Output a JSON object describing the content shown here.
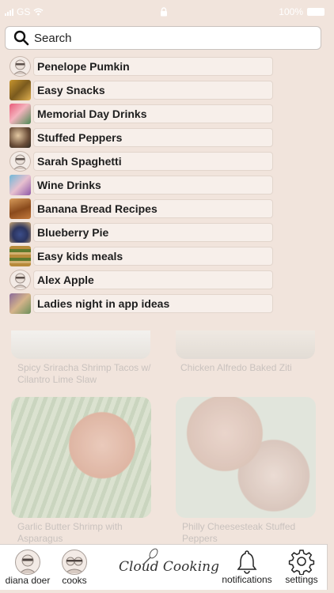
{
  "status_bar": {
    "carrier": "GS",
    "battery": "100%"
  },
  "search": {
    "placeholder": "Search",
    "value": ""
  },
  "results": [
    {
      "label": "Penelope Pumkin",
      "thumb": "avatar"
    },
    {
      "label": "Easy Snacks",
      "thumb": "food"
    },
    {
      "label": "Memorial Day Drinks",
      "thumb": "food"
    },
    {
      "label": "Stuffed Peppers",
      "thumb": "food"
    },
    {
      "label": "Sarah Spaghetti",
      "thumb": "avatar"
    },
    {
      "label": "Wine Drinks",
      "thumb": "food"
    },
    {
      "label": "Banana Bread Recipes",
      "thumb": "food"
    },
    {
      "label": "Blueberry Pie",
      "thumb": "food"
    },
    {
      "label": "Easy kids meals",
      "thumb": "food"
    },
    {
      "label": "Alex Apple",
      "thumb": "avatar"
    },
    {
      "label": "Ladies night in app ideas",
      "thumb": "food"
    }
  ],
  "feed": {
    "cards": [
      {
        "title": "Spicy Sriracha Shrimp Tacos w/ Cilantro Lime Slaw"
      },
      {
        "title": "Chicken Alfredo Baked Ziti"
      },
      {
        "title": "Garlic Butter Shrimp with Asparagus"
      },
      {
        "title": "Philly Cheesesteak Stuffed Peppers"
      }
    ]
  },
  "nav": {
    "profile_label": "diana doer",
    "cooks_label": "cooks",
    "brand": "Cloud Cooking",
    "notifications_label": "notifications",
    "settings_label": "settings"
  },
  "colors": {
    "background": "#f1e4dc",
    "pill": "#f7efea",
    "text": "#1e1e1e",
    "muted_text": "#c9c2be"
  }
}
